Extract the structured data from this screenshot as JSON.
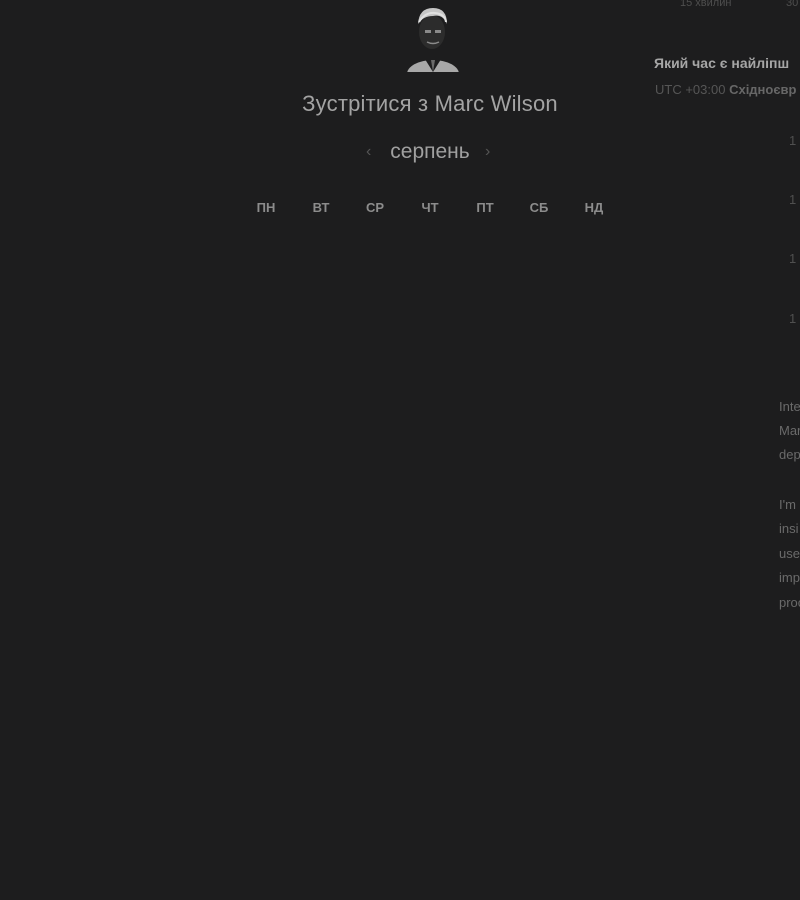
{
  "host": {
    "title": "Зустрітися з Marc Wilson"
  },
  "calendar": {
    "month": "серпень",
    "prev_arrow": "‹",
    "next_arrow": "›",
    "weekdays": [
      "ПН",
      "ВТ",
      "СР",
      "ЧТ",
      "ПТ",
      "СБ",
      "НД"
    ]
  },
  "duration": {
    "options": [
      "15 хвилин",
      "30"
    ]
  },
  "time_panel": {
    "question": "Який час є найліпш",
    "timezone_prefix": "UTC +03:00",
    "timezone_name": "Східноєвр",
    "slots": [
      "1",
      "1",
      "1",
      "1"
    ]
  },
  "description": {
    "lines": [
      "Inte",
      "Mar",
      "dep",
      "I'm",
      "insi",
      "use",
      "imp",
      "proc"
    ]
  },
  "colors": {
    "background": "#1d1d1e",
    "text_primary": "#a3a3a3",
    "text_muted": "#4f4f4f"
  }
}
